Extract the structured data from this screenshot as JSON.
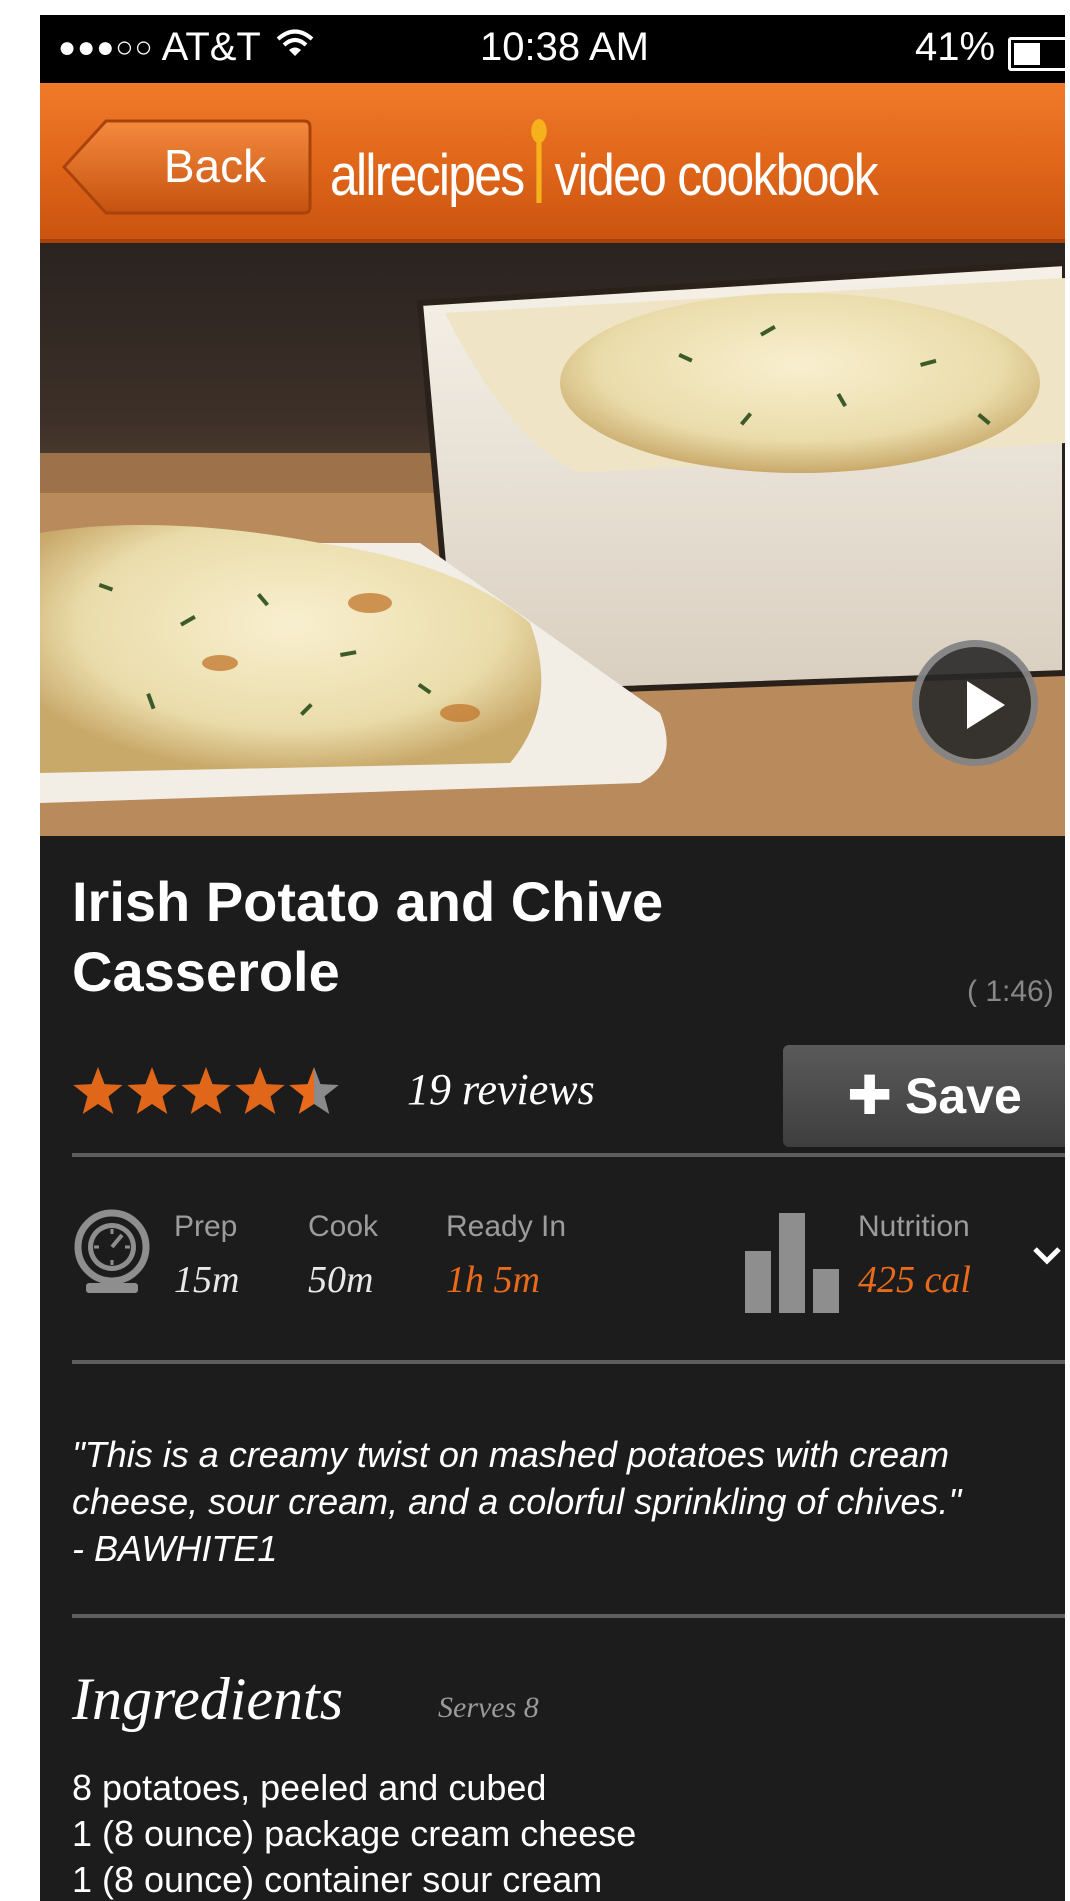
{
  "status_bar": {
    "carrier": "AT&T",
    "signal_dots": "●●●○○",
    "time": "10:38 AM",
    "battery_percent": "41%",
    "battery_level": 0.41
  },
  "header": {
    "back_label": "Back",
    "brand_left": "allrecipes",
    "brand_right": "video cookbook",
    "accent_color": "#e0661a"
  },
  "video": {
    "play_icon": "play-icon",
    "duration": "( 1:46)"
  },
  "recipe": {
    "title_line1": "Irish Potato and Chive",
    "title_line2": "Casserole",
    "rating": 4.5,
    "rating_max": 5,
    "reviews": "19 reviews",
    "save_label": "Save"
  },
  "times": {
    "prep_label": "Prep",
    "prep_value": "15m",
    "cook_label": "Cook",
    "cook_value": "50m",
    "ready_label": "Ready In",
    "ready_value": "1h 5m",
    "nutrition_label": "Nutrition",
    "nutrition_value": "425 cal"
  },
  "quote": {
    "line1": "\"This is a creamy twist on mashed potatoes with cream",
    "line2": "cheese, sour cream, and a colorful sprinkling of chives.\"",
    "line3": "- BAWHITE1"
  },
  "ingredients": {
    "heading": "Ingredients",
    "serves": "Serves 8",
    "items": [
      "8 potatoes, peeled and cubed",
      "1 (8 ounce) package cream cheese",
      "1 (8 ounce) container sour cream"
    ]
  }
}
